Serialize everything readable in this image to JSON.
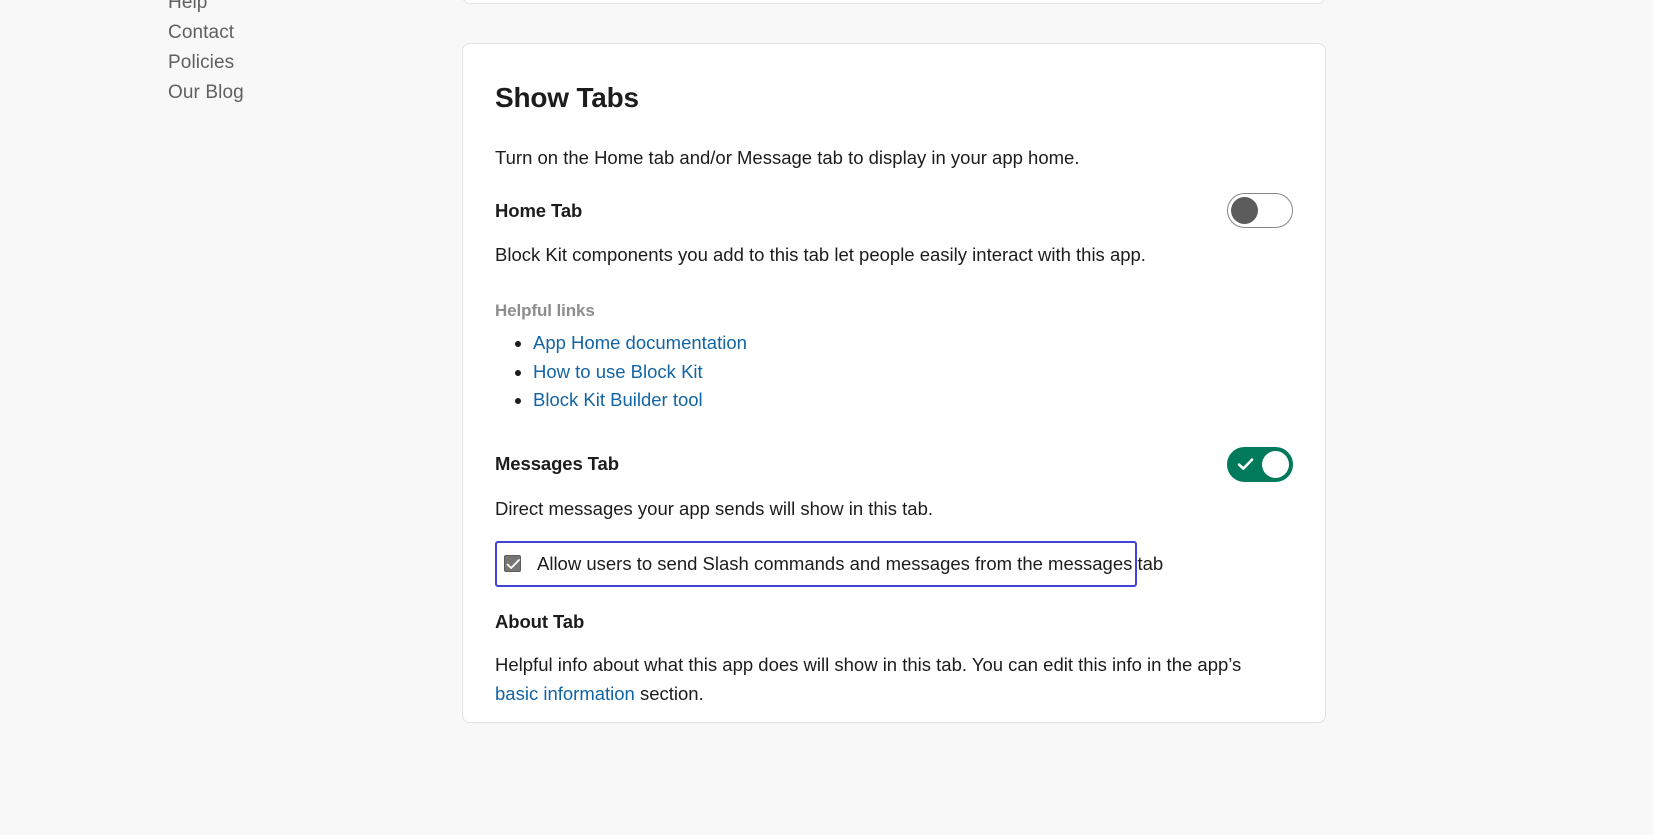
{
  "footer_nav": {
    "items": [
      {
        "label": "Help"
      },
      {
        "label": "Contact"
      },
      {
        "label": "Policies"
      },
      {
        "label": "Our Blog"
      }
    ]
  },
  "card": {
    "title": "Show Tabs",
    "intro": "Turn on the Home tab and/or Message tab to display in your app home.",
    "home_tab": {
      "heading": "Home Tab",
      "toggle_state": "off",
      "description": "Block Kit components you add to this tab let people easily interact with this app.",
      "helpful_links_title": "Helpful links",
      "helpful_links": [
        {
          "label": "App Home documentation"
        },
        {
          "label": "How to use Block Kit"
        },
        {
          "label": "Block Kit Builder tool"
        }
      ]
    },
    "messages_tab": {
      "heading": "Messages Tab",
      "toggle_state": "on",
      "description": "Direct messages your app sends will show in this tab.",
      "checkbox_label": "Allow users to send Slash commands and messages from the messages tab",
      "checkbox_checked": "checked"
    },
    "about_tab": {
      "heading": "About Tab",
      "description_part1": "Helpful info about what this app does will show in this tab. You can edit this info in the app’s ",
      "link_label": "basic information",
      "description_part2": " section."
    }
  },
  "colors": {
    "toggle_on": "#007a5a",
    "link_blue": "#1264a3",
    "focus_ring": "#4242d8",
    "page_bg": "#f8f8f8"
  }
}
